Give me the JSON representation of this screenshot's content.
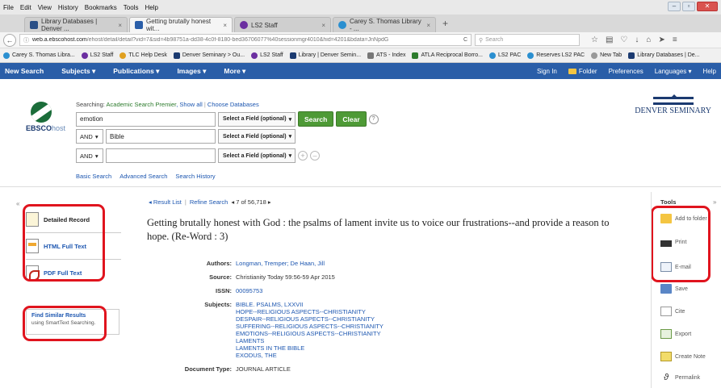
{
  "menubar": [
    "File",
    "Edit",
    "View",
    "History",
    "Bookmarks",
    "Tools",
    "Help"
  ],
  "tabs": [
    {
      "label": "Library Databases | Denver ...",
      "color": "#2a4f86",
      "active": false
    },
    {
      "label": "Getting brutally honest wit...",
      "color": "#2a5ea8",
      "active": true
    },
    {
      "label": "LS2 Staff",
      "color": "#6b2fa0",
      "active": false
    },
    {
      "label": "Carey S. Thomas Library - ...",
      "color": "#2a8fd0",
      "active": false
    }
  ],
  "url": {
    "domain": "web.a.ebscohost.com",
    "path": "/ehost/detail/detail?vid=7&sid=4b98751a-dd38-4c0f-8180-bed36706077%40sessionmgr4010&hid=4201&bdata=JnNpdG",
    "search_placeholder": "Search"
  },
  "bookmarks": [
    "Carey S. Thomas Libra...",
    "LS2 Staff",
    "TLC Help Desk",
    "Denver Seminary > Ou...",
    "LS2 Staff",
    "Library | Denver Semin...",
    "ATS - Index",
    "ATLA Reciprocal Borro...",
    "LS2 PAC",
    "Reserves LS2 PAC",
    "New Tab",
    "Library Databases | De..."
  ],
  "toolbar": {
    "left": [
      "New Search",
      "Subjects ▾",
      "Publications ▾",
      "Images ▾",
      "More ▾"
    ],
    "right": [
      "Sign In",
      "Folder",
      "Preferences",
      "Languages ▾",
      "Help"
    ]
  },
  "logo": {
    "brand": "EBSCO",
    "suffix": "host"
  },
  "search": {
    "searching_prefix": "Searching: ",
    "database": "Academic Search Premier",
    "show_all": ", Show all",
    "choose": "Choose Databases",
    "rows": [
      {
        "bool": "",
        "term": "emotion",
        "field": "Select a Field (optional)"
      },
      {
        "bool": "AND",
        "term": "Bible",
        "field": "Select a Field (optional)"
      },
      {
        "bool": "AND",
        "term": "",
        "field": "Select a Field (optional)"
      }
    ],
    "search_btn": "Search",
    "clear_btn": "Clear",
    "links": [
      "Basic Search",
      "Advanced Search",
      "Search History"
    ]
  },
  "seminary": "DENVER SEMINARY",
  "left_panel": {
    "items": [
      "Detailed Record",
      "HTML Full Text",
      "PDF Full Text"
    ],
    "similar_title": "Find Similar Results",
    "similar_sub": "using SmartText Searching."
  },
  "record": {
    "result_list": "◂ Result List",
    "refine": "Refine Search",
    "position": "◂  7 of 56,718  ▸",
    "title": "Getting brutally honest with God : the psalms of lament invite us to voice our frustrations--and provide a reason to hope. (Re-Word : 3)",
    "authors_label": "Authors:",
    "authors": "Longman, Tremper; De Haan, Jill",
    "source_label": "Source:",
    "source": "Christianity Today 59:56-59 Apr 2015",
    "issn_label": "ISSN:",
    "issn": "00095753",
    "subjects_label": "Subjects:",
    "subjects": [
      "BIBLE. PSALMS, LXXVII",
      "HOPE--RELIGIOUS ASPECTS--CHRISTIANITY",
      "DESPAIR--RELIGIOUS ASPECTS--CHRISTIANITY",
      "SUFFERING--RELIGIOUS ASPECTS--CHRISTIANITY",
      "EMOTIONS--RELIGIOUS ASPECTS--CHRISTIANITY",
      "LAMENTS",
      "LAMENTS IN THE BIBLE",
      "EXODUS, THE"
    ],
    "doctype_label": "Document Type:",
    "doctype": "JOURNAL ARTICLE"
  },
  "tools": {
    "title": "Tools",
    "items": [
      "Add to folder",
      "Print",
      "E-mail",
      "Save",
      "Cite",
      "Export",
      "Create Note",
      "Permalink"
    ]
  },
  "colors": {
    "ebsco_blue": "#2a5ea8",
    "green_button": "#4e9a36",
    "highlight_red": "#e0141e",
    "link_blue": "#1c56b0"
  }
}
